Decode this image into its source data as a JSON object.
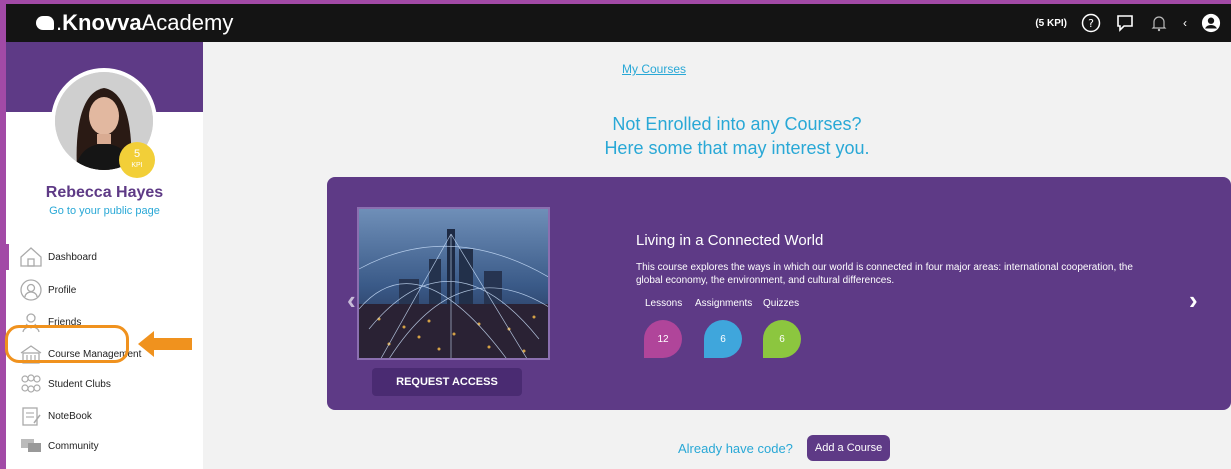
{
  "brand": {
    "logo_bold": "Knovva",
    "logo_light": "Academy",
    "dot": "."
  },
  "topbar": {
    "kpi": "(5 KPI)",
    "back": "‹"
  },
  "profile": {
    "kpi_value": "5",
    "kpi_unit": "KPI",
    "name": "Rebecca Hayes",
    "public_link": "Go to your public page"
  },
  "nav": {
    "items": [
      {
        "label": "Dashboard",
        "icon": "home-icon"
      },
      {
        "label": "Profile",
        "icon": "profile-icon"
      },
      {
        "label": "Friends",
        "icon": "friends-icon"
      },
      {
        "label": "Course Management",
        "icon": "course-management-icon"
      },
      {
        "label": "Student Clubs",
        "icon": "student-clubs-icon"
      },
      {
        "label": "NoteBook",
        "icon": "notebook-icon"
      },
      {
        "label": "Community",
        "icon": "community-icon"
      }
    ]
  },
  "main": {
    "my_courses": "My Courses",
    "headline_1": "Not Enrolled into any Courses?",
    "headline_2": "Here some that may interest you.",
    "course": {
      "title": "Living in a Connected World",
      "description": "This course explores the ways in which our world is connected in four major areas: international cooperation, the global economy, the environment, and cultural differences.",
      "labels": {
        "lessons": "Lessons",
        "assignments": "Assignments",
        "quizzes": "Quizzes"
      },
      "counts": {
        "lessons": "12",
        "assignments": "6",
        "quizzes": "6"
      },
      "request_label": "REQUEST ACCESS",
      "prev": "‹",
      "next": "›"
    },
    "code_text": "Already have code?",
    "add_course": "Add a Course"
  },
  "colors": {
    "frame": "#a24aa6",
    "purple": "#5e3a86",
    "accent_blue": "#29a8d6",
    "highlight": "#f0921e",
    "lessons": "#b0459a",
    "assignments": "#3fa6dc",
    "quizzes": "#8cc63f"
  }
}
